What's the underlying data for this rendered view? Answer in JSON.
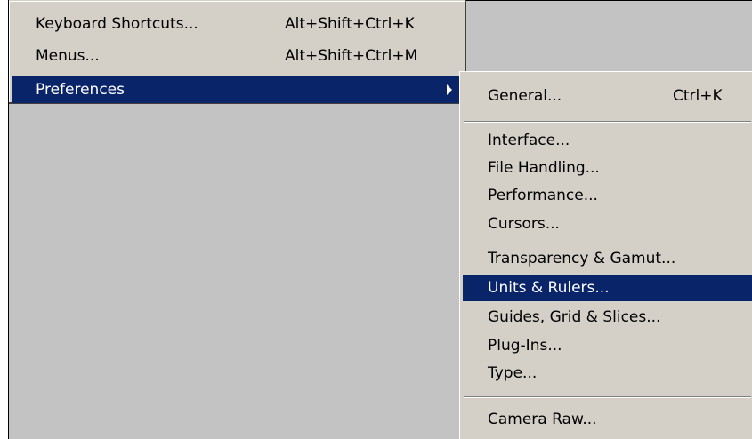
{
  "main_menu": {
    "items": [
      {
        "label": "Keyboard Shortcuts...",
        "shortcut": "Alt+Shift+Ctrl+K"
      },
      {
        "label": "Menus...",
        "shortcut": "Alt+Shift+Ctrl+M"
      },
      {
        "label": "Preferences",
        "shortcut": ""
      }
    ]
  },
  "submenu": {
    "items": [
      {
        "label": "General...",
        "shortcut": "Ctrl+K"
      },
      {
        "label": "Interface...",
        "shortcut": ""
      },
      {
        "label": "File Handling...",
        "shortcut": ""
      },
      {
        "label": "Performance...",
        "shortcut": ""
      },
      {
        "label": "Cursors...",
        "shortcut": ""
      },
      {
        "label": "Transparency & Gamut...",
        "shortcut": ""
      },
      {
        "label": "Units & Rulers...",
        "shortcut": ""
      },
      {
        "label": "Guides, Grid & Slices...",
        "shortcut": ""
      },
      {
        "label": "Plug-Ins...",
        "shortcut": ""
      },
      {
        "label": "Type...",
        "shortcut": ""
      },
      {
        "label": "Camera Raw...",
        "shortcut": ""
      }
    ]
  },
  "colors": {
    "menu_bg": "#d4d0c8",
    "highlight_bg": "#0a246a",
    "highlight_text": "#ffffff",
    "desktop_bg": "#c3c3c3"
  }
}
